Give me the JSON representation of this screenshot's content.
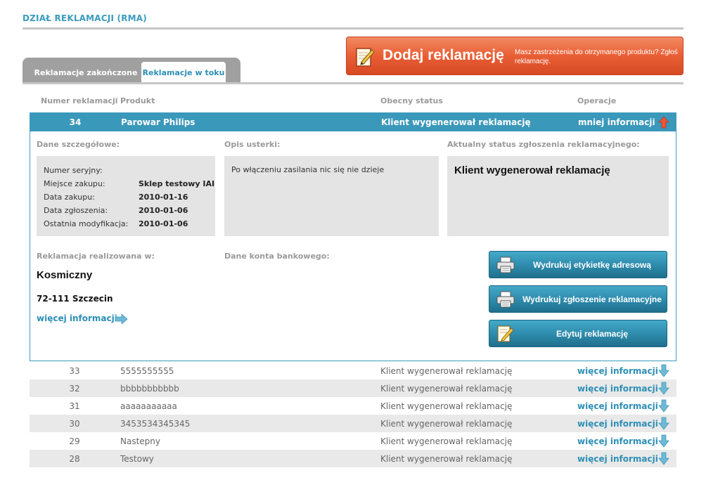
{
  "header": {
    "title": "DZIAŁ REKLAMACJI (RMA)"
  },
  "tabs": [
    {
      "label": "Reklamacje zakończone"
    },
    {
      "label": "Reklamacje w toku"
    }
  ],
  "add_button": {
    "label": "Dodaj reklamację",
    "description": "Masz zastrzeżenia do otrzymanego produktu? Zgłoś reklamację."
  },
  "columns": {
    "number": "Numer reklamacji",
    "product": "Produkt",
    "status": "Obecny status",
    "operations": "Operacje"
  },
  "expanded": {
    "number": "34",
    "product": "Parowar Philips",
    "status": "Klient wygenerował reklamację",
    "less_info": "mniej informacji",
    "details_label": "Dane szczegółowe:",
    "details": [
      {
        "key": "Numer seryjny:",
        "value": ""
      },
      {
        "key": "Miejsce zakupu:",
        "value": "Sklep testowy IAI"
      },
      {
        "key": "Data zakupu:",
        "value": "2010-01-16"
      },
      {
        "key": "Data zgłoszenia:",
        "value": "2010-01-06"
      },
      {
        "key": "Ostatnia modyfikacja:",
        "value": "2010-01-06"
      }
    ],
    "defect_label": "Opis usterki:",
    "defect_text": "Po włączeniu zasilania nic się nie dzieje",
    "current_status_label": "Aktualny status zgłoszenia reklamacyjnego:",
    "current_status": "Klient wygenerował reklamację",
    "realized_label": "Reklamacja realizowana w:",
    "realized_name": "Kosmiczny",
    "realized_city": "72-111 Szczecin",
    "more_info": "więcej informacji",
    "bank_label": "Dane konta bankowego:",
    "buttons": {
      "print_label": "Wydrukuj etykietkę adresową",
      "print_claim": "Wydrukuj zgłoszenie reklamacyjne",
      "edit": "Edytuj reklamację"
    }
  },
  "rows": [
    {
      "number": "33",
      "product": "5555555555",
      "status": "Klient wygenerował reklamację",
      "more": "więcej informacji"
    },
    {
      "number": "32",
      "product": "bbbbbbbbbbb",
      "status": "Klient wygenerował reklamację",
      "more": "więcej informacji"
    },
    {
      "number": "31",
      "product": "aaaaaaaaaaa",
      "status": "Klient wygenerował reklamację",
      "more": "więcej informacji"
    },
    {
      "number": "30",
      "product": "3453534345345",
      "status": "Klient wygenerował reklamację",
      "more": "więcej informacji"
    },
    {
      "number": "29",
      "product": "Nastepny",
      "status": "Klient wygenerował reklamację",
      "more": "więcej informacji"
    },
    {
      "number": "28",
      "product": "Testowy",
      "status": "Klient wygenerował reklamację",
      "more": "więcej informacji"
    }
  ],
  "colors": {
    "accent": "#3a98ba",
    "add_button": "#e95e35"
  }
}
